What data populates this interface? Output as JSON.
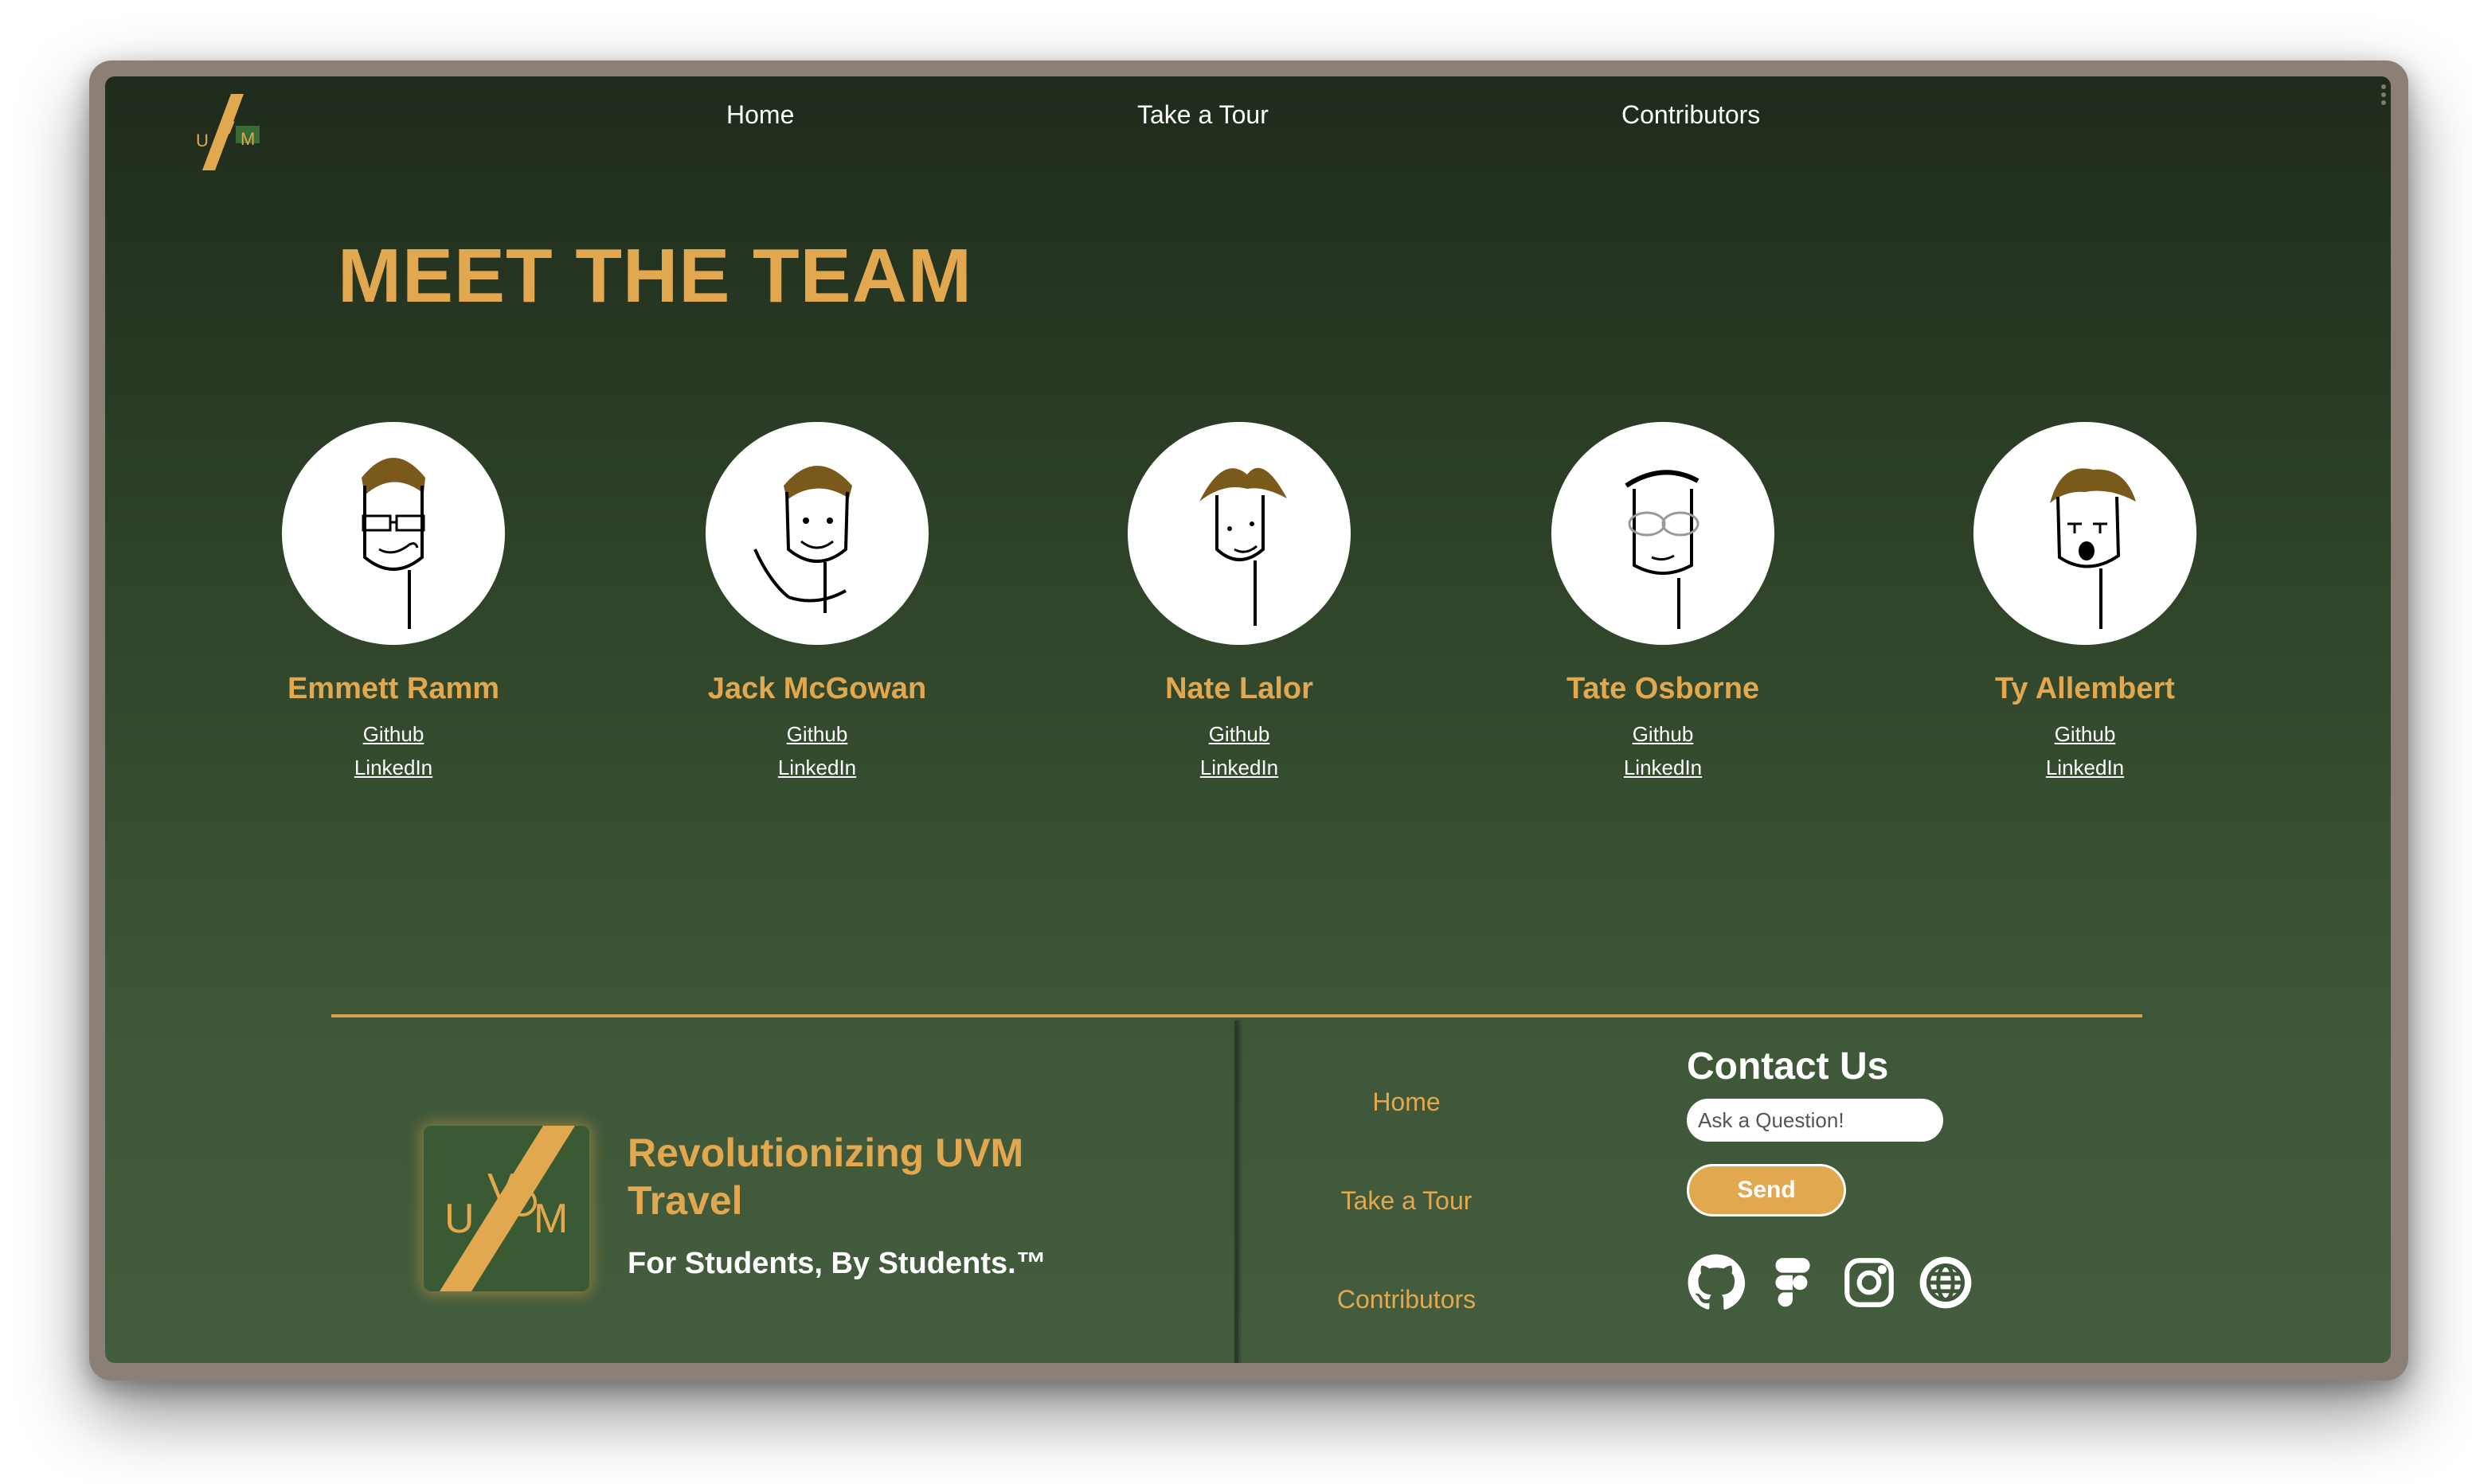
{
  "nav": {
    "logo_alt": "UVM",
    "links": [
      "Home",
      "Take a Tour",
      "Contributors"
    ]
  },
  "page_title": "MEET THE TEAM",
  "team": [
    {
      "name": "Emmett Ramm",
      "github": "Github",
      "linkedin": "LinkedIn"
    },
    {
      "name": "Jack McGowan",
      "github": "Github",
      "linkedin": "LinkedIn"
    },
    {
      "name": "Nate Lalor",
      "github": "Github",
      "linkedin": "LinkedIn"
    },
    {
      "name": "Tate Osborne",
      "github": "Github",
      "linkedin": "LinkedIn"
    },
    {
      "name": "Ty Allembert",
      "github": "Github",
      "linkedin": "LinkedIn"
    }
  ],
  "footer": {
    "tagline": "Revolutionizing UVM Travel",
    "slogan": "For Students, By Students.™",
    "links": [
      "Home",
      "Take a Tour",
      "Contributors"
    ],
    "contact": {
      "title": "Contact Us",
      "placeholder": "Ask a Question!",
      "send_label": "Send"
    },
    "social_icons": [
      "github-icon",
      "figma-icon",
      "instagram-icon",
      "globe-icon"
    ]
  },
  "colors": {
    "accent": "#e2a850",
    "background_top": "#1f2b1c",
    "background_bottom": "#445d3e",
    "logo_green": "#3a5a34"
  }
}
